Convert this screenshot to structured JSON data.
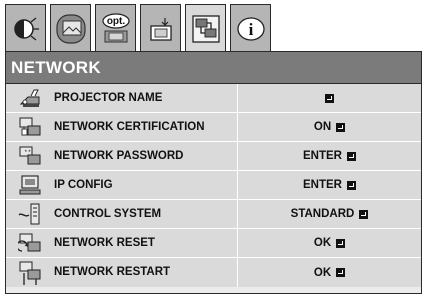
{
  "menu": {
    "title": "NETWORK",
    "tabs": [
      {
        "name": "tab-picture-adjust",
        "icon": "brightness-icon",
        "text": ""
      },
      {
        "name": "tab-image-select",
        "icon": "image-icon",
        "text": ""
      },
      {
        "name": "tab-option",
        "icon": "option-icon",
        "text": "opt."
      },
      {
        "name": "tab-setting",
        "icon": "setting-icon",
        "text": ""
      },
      {
        "name": "tab-network",
        "icon": "network-icon",
        "text": "",
        "active": true
      },
      {
        "name": "tab-information",
        "icon": "information-icon",
        "text": "i"
      }
    ],
    "rows": [
      {
        "label": "PROJECTOR NAME",
        "value": "",
        "icon": "projector-name-icon"
      },
      {
        "label": "NETWORK CERTIFICATION",
        "value": "ON",
        "icon": "network-certification-icon"
      },
      {
        "label": "NETWORK PASSWORD",
        "value": "ENTER",
        "icon": "network-password-icon"
      },
      {
        "label": "IP CONFIG",
        "value": "ENTER",
        "icon": "ip-config-icon"
      },
      {
        "label": "CONTROL SYSTEM",
        "value": "STANDARD",
        "icon": "control-system-icon"
      },
      {
        "label": "NETWORK RESET",
        "value": "OK",
        "icon": "network-reset-icon"
      },
      {
        "label": "NETWORK RESTART",
        "value": "OK",
        "icon": "network-restart-icon"
      }
    ]
  }
}
